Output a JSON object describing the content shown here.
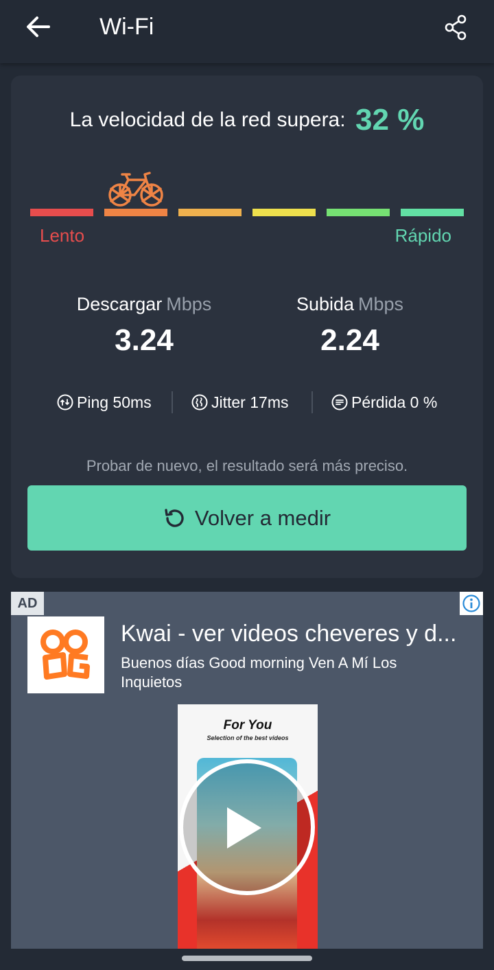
{
  "colors": {
    "accent": "#62d6b1",
    "slow": "#e74d4d",
    "scale": [
      "#e74d4d",
      "#ef8445",
      "#efb14e",
      "#eee04d",
      "#76e173",
      "#62e0a4"
    ],
    "bike": "#ef8445"
  },
  "header": {
    "title": "Wi-Fi",
    "back_icon": "arrow-left-icon",
    "share_icon": "share-icon"
  },
  "result": {
    "headline": "La velocidad de la red supera:",
    "percent": "32 %",
    "percent_value": 32,
    "level_icon": "bicycle-icon",
    "level_index": 1,
    "scale_labels": {
      "slow": "Lento",
      "fast": "Rápido"
    }
  },
  "metrics": {
    "download": {
      "label": "Descargar",
      "unit": "Mbps",
      "value": "3.24"
    },
    "upload": {
      "label": "Subida",
      "unit": "Mbps",
      "value": "2.24"
    }
  },
  "stats": {
    "ping": "Ping 50ms",
    "jitter": "Jitter 17ms",
    "loss": "Pérdida 0 %"
  },
  "retest": {
    "hint": "Probar de nuevo, el resultado será más preciso.",
    "button_label": "Volver a medir",
    "icon": "refresh-icon"
  },
  "ad": {
    "badge": "AD",
    "title": "Kwai - ver videos cheveres y d...",
    "subtitle": "Buenos días Good morning Ven A Mí Los Inquietos",
    "video_title": "For You",
    "video_subtitle": "Selection of the best videos"
  }
}
